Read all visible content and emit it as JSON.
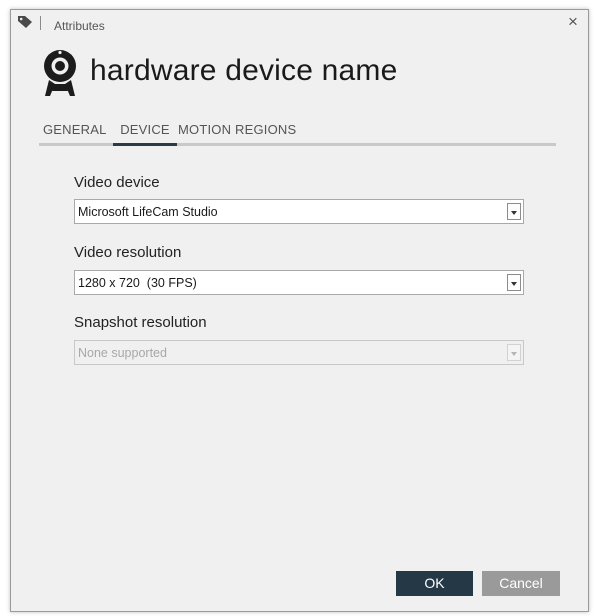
{
  "titlebar": {
    "title": "Attributes",
    "close_glyph": "×",
    "icon": "tag-icon"
  },
  "header": {
    "device_icon": "webcam-icon",
    "device_name": "hardware device name"
  },
  "tabs": [
    {
      "label": "GENERAL",
      "active": false
    },
    {
      "label": "DEVICE",
      "active": true
    },
    {
      "label": "MOTION REGIONS",
      "active": false
    }
  ],
  "form": {
    "video_device": {
      "label": "Video device",
      "value": "Microsoft LifeCam Studio",
      "enabled": true
    },
    "video_resolution": {
      "label": "Video resolution",
      "value": "1280 x 720  (30 FPS)",
      "enabled": true
    },
    "snapshot_resolution": {
      "label": "Snapshot resolution",
      "value": "None supported",
      "enabled": false
    }
  },
  "buttons": {
    "ok": "OK",
    "cancel": "Cancel"
  },
  "colors": {
    "window_bg": "#f0f0f1",
    "accent": "#253845",
    "cancel_bg": "#9a9a9a",
    "tab_indicator": "#2b3a45"
  }
}
